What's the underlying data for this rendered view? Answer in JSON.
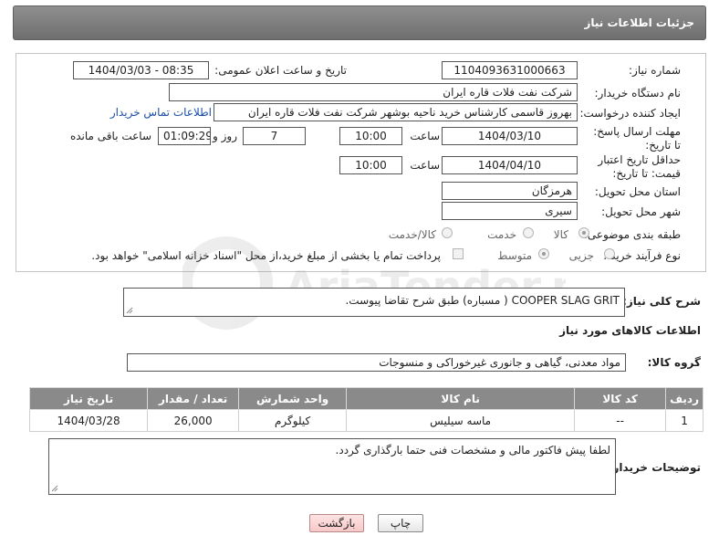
{
  "header": {
    "title": "جزئیات اطلاعات نیاز"
  },
  "form": {
    "need_number_label": "شماره نیاز:",
    "need_number": "1104093631000663",
    "announce_label": "تاریخ و ساعت اعلان عمومی:",
    "announce_value": "1404/03/03 - 08:35",
    "buyer_org_label": "نام دستگاه خریدار:",
    "buyer_org": "شرکت نفت فلات قاره ایران",
    "creator_label": "ایجاد کننده درخواست:",
    "creator": "بهروز قاسمی کارشناس خرید ناحیه بوشهر شرکت نفت فلات قاره ایران",
    "contact_link": "اطلاعات تماس خریدار",
    "reply_deadline_label": "مهلت ارسال پاسخ: تا تاریخ:",
    "reply_date": "1404/03/10",
    "time_label": "ساعت",
    "reply_time": "10:00",
    "days_value": "7",
    "days_label": "روز و",
    "remaining_time": "01:09:29",
    "remaining_label": "ساعت باقی مانده",
    "price_validity_label": "حداقل تاریخ اعتبار قیمت: تا تاریخ:",
    "price_date": "1404/04/10",
    "price_time": "10:00",
    "province_label": "استان محل تحویل:",
    "province": "هرمزگان",
    "city_label": "شهر محل تحویل:",
    "city": "سیری",
    "category_label": "طبقه بندی موضوعی:",
    "category_options": [
      "کالا",
      "خدمت",
      "کالا/خدمت"
    ],
    "process_label": "نوع فرآیند خرید :",
    "process_options": [
      "جزیی",
      "متوسط"
    ],
    "payment_note": "پرداخت تمام یا بخشی از مبلغ خرید،از محل \"اسناد خزانه اسلامی\" خواهد بود."
  },
  "general_desc": {
    "label": "شرح کلی نیاز:",
    "text": "COOPER SLAG GRIT ( مسباره) طبق شرح تقاضا پیوست."
  },
  "goods_info_title": "اطلاعات کالاهای مورد نیاز",
  "goods_group": {
    "label": "گروه کالا:",
    "value": "مواد معدنی، گیاهی و جانوری غیرخوراکی و منسوجات"
  },
  "table": {
    "headers": [
      "ردیف",
      "کد کالا",
      "نام کالا",
      "واحد شمارش",
      "تعداد / مقدار",
      "تاریخ نیاز"
    ],
    "rows": [
      [
        "1",
        "--",
        "ماسه سیلیس",
        "کیلوگرم",
        "26,000",
        "1404/03/28"
      ]
    ]
  },
  "buyer_notes": {
    "label": "توضیحات خریدار:",
    "text": "لطفا پیش فاکتور مالی و مشخصات فنی حتما بارگذاری گردد."
  },
  "buttons": {
    "print": "چاپ",
    "back": "بازگشت"
  },
  "watermark": {
    "brand": "AriaTender.net",
    "accent": "#e4522a"
  }
}
